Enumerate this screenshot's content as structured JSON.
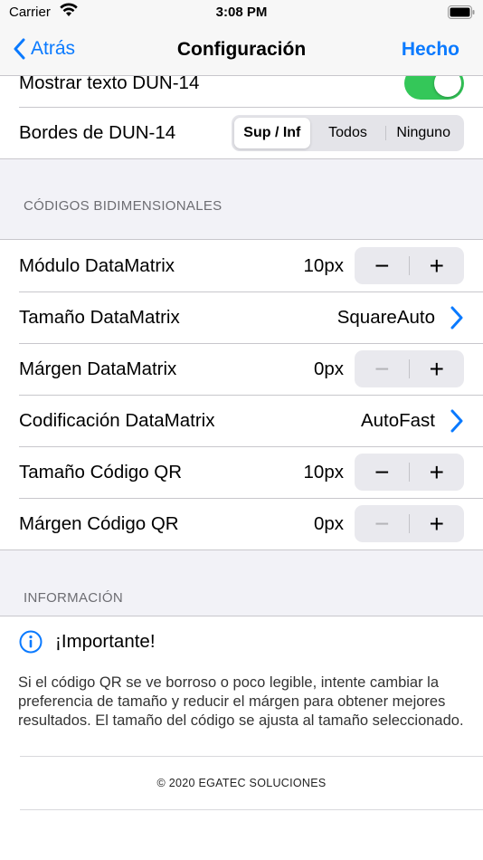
{
  "status_bar": {
    "carrier": "Carrier",
    "time": "3:08 PM"
  },
  "nav": {
    "back_label": "Atrás",
    "title": "Configuración",
    "done_label": "Hecho"
  },
  "dun14": {
    "show_text_label": "Mostrar texto DUN-14",
    "show_text_on": true,
    "borders_label": "Bordes de DUN-14",
    "borders_options": [
      "Sup / Inf",
      "Todos",
      "Ninguno"
    ],
    "borders_selected": "Sup / Inf"
  },
  "two_d": {
    "header": "CÓDIGOS BIDIMENSIONALES",
    "rows": {
      "dm_module": {
        "label": "Módulo DataMatrix",
        "value": "10px"
      },
      "dm_size": {
        "label": "Tamaño DataMatrix",
        "value": "SquareAuto"
      },
      "dm_margin": {
        "label": "Márgen DataMatrix",
        "value": "0px"
      },
      "dm_encoding": {
        "label": "Codificación DataMatrix",
        "value": "AutoFast"
      },
      "qr_size": {
        "label": "Tamaño Código QR",
        "value": "10px"
      },
      "qr_margin": {
        "label": "Márgen Código QR",
        "value": "0px"
      }
    },
    "stepper_minus": "−",
    "stepper_plus": "+"
  },
  "info": {
    "header": "INFORMACIÓN",
    "title": "¡Importante!",
    "body": "Si el código QR se ve borroso o poco legible, intente cambiar la preferencia de tamaño y reducir el márgen para obtener mejores resultados. El tamaño del código se ajusta al tamaño seleccionado."
  },
  "footer": {
    "copyright": "© 2020 EGATEC SOLUCIONES"
  },
  "colors": {
    "accent": "#0a7aff",
    "toggle_on": "#34c759"
  }
}
